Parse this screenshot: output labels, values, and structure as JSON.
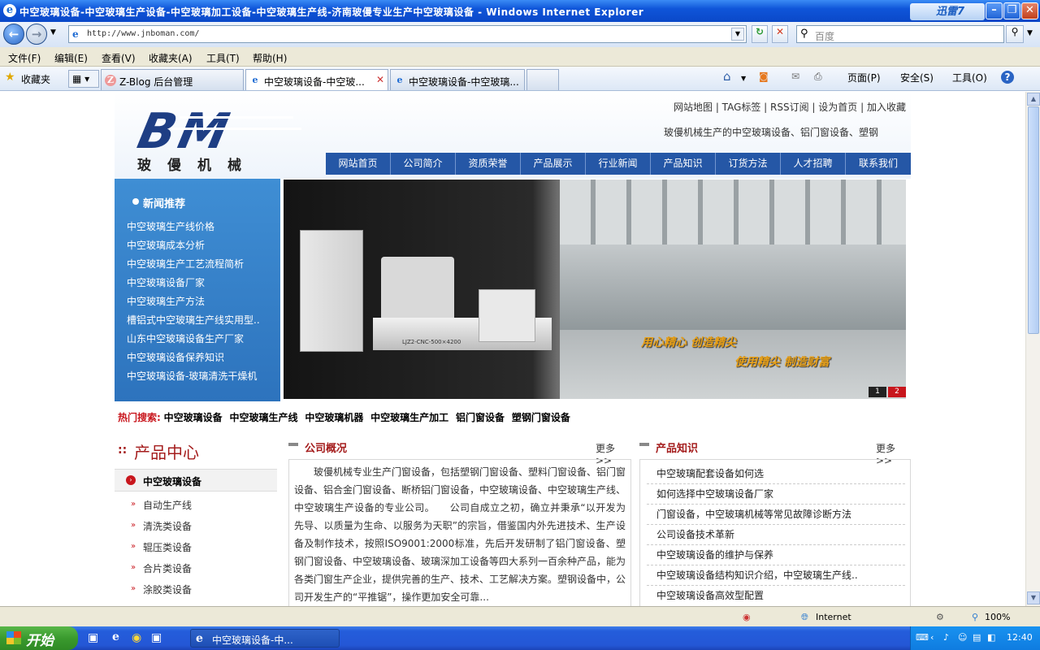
{
  "window": {
    "title": "中空玻璃设备-中空玻璃生产设备-中空玻璃加工设备-中空玻璃生产线-济南玻僈专业生产中空玻璃设备 - Windows Internet Explorer",
    "xunlei_label": "迅雷7"
  },
  "address_bar": {
    "url": "http://www.jnboman.com/",
    "search_placeholder": "百度"
  },
  "menu": [
    "文件(F)",
    "编辑(E)",
    "查看(V)",
    "收藏夹(A)",
    "工具(T)",
    "帮助(H)"
  ],
  "favorites_label": "收藏夹",
  "tabs": [
    {
      "label": "Z-Blog 后台管理",
      "active": false
    },
    {
      "label": "中空玻璃设备-中空玻...",
      "active": true
    },
    {
      "label": "中空玻璃设备-中空玻璃...",
      "active": false
    }
  ],
  "command_bar": {
    "page": "页面(P)",
    "safety": "安全(S)",
    "tools": "工具(O)"
  },
  "site": {
    "logo_text": "BM",
    "brand": "玻僈机械",
    "top_links": "网站地图 | TAG标签 | RSS订阅 | 设为首页 | 加入收藏",
    "tagline": "玻僈机械生产的中空玻璃设备、铝门窗设备、塑钢",
    "nav": [
      "网站首页",
      "公司简介",
      "资质荣誉",
      "产品展示",
      "行业新闻",
      "产品知识",
      "订货方法",
      "人才招聘",
      "联系我们"
    ],
    "news": {
      "title": "新闻推荐",
      "items": [
        "中空玻璃生产线价格",
        "中空玻璃成本分析",
        "中空玻璃生产工艺流程简析",
        "中空玻璃设备厂家",
        "中空玻璃生产方法",
        "槽铝式中空玻璃生产线实用型..",
        "山东中空玻璃设备生产厂家",
        "中空玻璃设备保养知识",
        "中空玻璃设备-玻璃清洗干燥机"
      ]
    },
    "banner": {
      "slogan_left": "用心精心  创造精尖",
      "slogan_right": "使用精尖  制造财富",
      "machine_label": "LJZ2-CNC-500×4200",
      "pages": [
        "1",
        "2"
      ],
      "active_page": "2"
    },
    "hot_search": {
      "label": "热门搜索:",
      "items": [
        "中空玻璃设备",
        "中空玻璃生产线",
        "中空玻璃机器",
        "中空玻璃生产加工",
        "铝门窗设备",
        "塑钢门窗设备"
      ]
    },
    "product_center": {
      "title": "产品中心",
      "category": "中空玻璃设备",
      "subcategories": [
        "自动生产线",
        "清洗类设备",
        "辊压类设备",
        "合片类设备",
        "涂胶类设备"
      ]
    },
    "company": {
      "title": "公司概况",
      "more": "更多>>",
      "text": "　　玻僈机械专业生产门窗设备，包括塑钢门窗设备、塑料门窗设备、铝门窗设备、铝合金门窗设备、断桥铝门窗设备，中空玻璃设备、中空玻璃生产线、中空玻璃生产设备的专业公司。　　公司自成立之初，确立并秉承“以开发为先导、以质量为生命、以服务为天职”的宗旨，借鉴国内外先进技术、生产设备及制作技术，按照ISO9001:2000标准，先后开发研制了铝门窗设备、塑钢门窗设备、中空玻璃设备、玻璃深加工设备等四大系列一百余种产品，能为各类门窗生产企业，提供完善的生产、技术、工艺解决方案。塑钢设备中，公司开发生产的“平推锯”，操作更加安全可靠..."
    },
    "knowledge": {
      "title": "产品知识",
      "more": "更多>>",
      "items": [
        "中空玻璃配套设备如何选",
        "如何选择中空玻璃设备厂家",
        "门窗设备，中空玻璃机械等常见故障诊断方法",
        "公司设备技术革新",
        "中空玻璃设备的维护与保养",
        "中空玻璃设备结构知识介绍，中空玻璃生产线..",
        "中空玻璃设备高效型配置"
      ]
    }
  },
  "status": {
    "zone": "Internet",
    "zoom": "100%"
  },
  "taskbar": {
    "start": "开始",
    "task": "中空玻璃设备-中...",
    "clock": "12:40"
  }
}
